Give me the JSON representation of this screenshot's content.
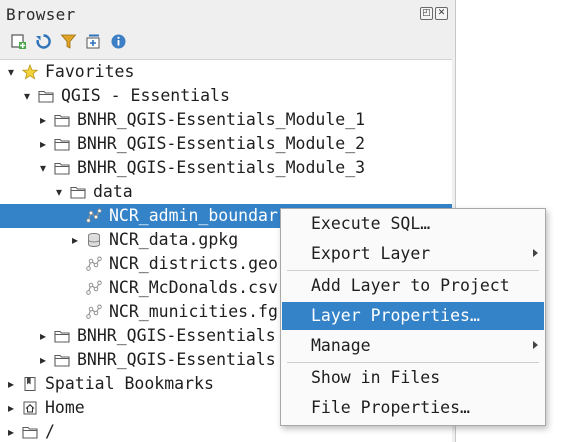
{
  "panel": {
    "title": "Browser",
    "toolbar": [
      {
        "name": "add-selected-layers-icon"
      },
      {
        "name": "refresh-icon"
      },
      {
        "name": "filter-icon"
      },
      {
        "name": "collapse-all-icon"
      },
      {
        "name": "info-icon"
      }
    ]
  },
  "tree": {
    "items": [
      {
        "label": "Favorites",
        "icon": "star-icon",
        "expanded": true
      },
      {
        "label": "QGIS - Essentials",
        "icon": "folder-icon",
        "expanded": true
      },
      {
        "label": "BNHR_QGIS-Essentials_Module_1",
        "icon": "folder-icon",
        "expanded": false
      },
      {
        "label": "BNHR_QGIS-Essentials_Module_2",
        "icon": "folder-icon",
        "expanded": false
      },
      {
        "label": "BNHR_QGIS-Essentials_Module_3",
        "icon": "folder-icon",
        "expanded": true
      },
      {
        "label": "data",
        "icon": "folder-icon",
        "expanded": true
      },
      {
        "label": "NCR_admin_boundar",
        "icon": "vector-layer-icon",
        "selected": true
      },
      {
        "label": "NCR_data.gpkg",
        "icon": "database-icon",
        "expanded": false
      },
      {
        "label": "NCR_districts.geo",
        "icon": "vector-layer-icon"
      },
      {
        "label": "NCR_McDonalds.csv",
        "icon": "vector-layer-icon"
      },
      {
        "label": "NCR_municities.fg",
        "icon": "vector-layer-icon"
      },
      {
        "label": "BNHR_QGIS-Essentials",
        "icon": "folder-icon",
        "expanded": false
      },
      {
        "label": "BNHR_QGIS-Essentials",
        "icon": "folder-icon",
        "expanded": false
      },
      {
        "label": "Spatial Bookmarks",
        "icon": "bookmark-icon",
        "expanded": false
      },
      {
        "label": "Home",
        "icon": "home-icon",
        "expanded": false
      },
      {
        "label": "/",
        "icon": "folder-icon",
        "expanded": false
      }
    ]
  },
  "context_menu": {
    "items": [
      {
        "label": "Execute SQL…",
        "submenu": false
      },
      {
        "label": "Export Layer",
        "submenu": true
      },
      {
        "label": "Add Layer to Project",
        "submenu": false
      },
      {
        "label": "Layer Properties…",
        "submenu": false,
        "highlighted": true
      },
      {
        "label": "Manage",
        "submenu": true
      },
      {
        "label": "Show in Files",
        "submenu": false
      },
      {
        "label": "File Properties…",
        "submenu": false
      }
    ]
  },
  "colors": {
    "selection": "#3483c9",
    "panel_bg": "#efefef",
    "tree_bg": "#ffffff"
  }
}
